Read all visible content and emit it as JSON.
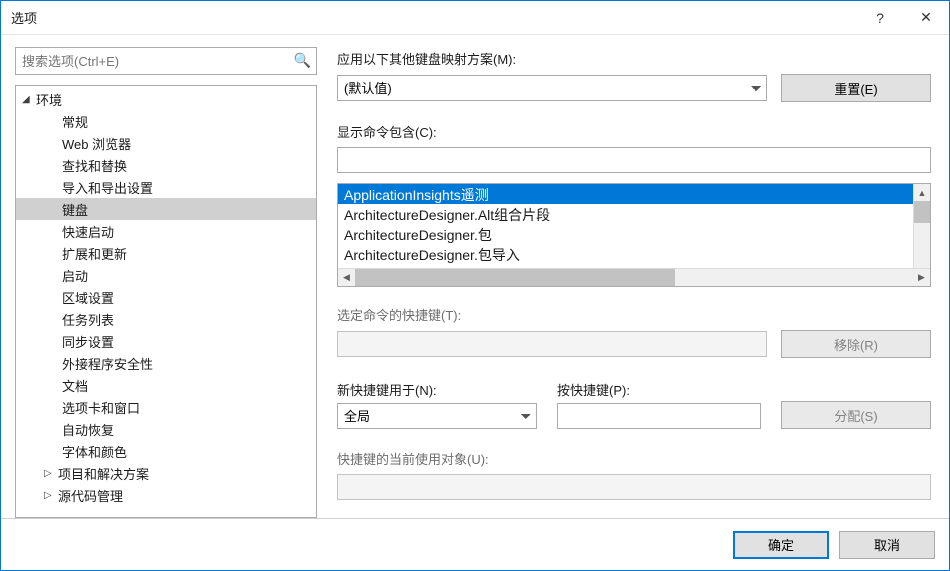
{
  "window": {
    "title": "选项",
    "help": "?",
    "close": "✕"
  },
  "search": {
    "placeholder": "搜索选项(Ctrl+E)",
    "value": ""
  },
  "tree": {
    "root": {
      "label": "环境",
      "expanded": true
    },
    "children": [
      "常规",
      "Web 浏览器",
      "查找和替换",
      "导入和导出设置",
      "键盘",
      "快速启动",
      "扩展和更新",
      "启动",
      "区域设置",
      "任务列表",
      "同步设置",
      "外接程序安全性",
      "文档",
      "选项卡和窗口",
      "自动恢复",
      "字体和颜色"
    ],
    "selectedIndex": 4,
    "siblings": [
      "项目和解决方案",
      "源代码管理"
    ]
  },
  "right": {
    "mappingLabel": "应用以下其他键盘映射方案(M):",
    "mappingValue": "(默认值)",
    "resetBtn": "重置(E)",
    "showCmdLabel": "显示命令包含(C):",
    "showCmdValue": "",
    "commands": [
      "ApplicationInsights遥测",
      "ArchitectureDesigner.Alt组合片段",
      "ArchitectureDesigner.包",
      "ArchitectureDesigner.包导入"
    ],
    "commandSelected": 0,
    "selectedShortcutLabel": "选定命令的快捷键(T):",
    "removeBtn": "移除(R)",
    "newShortcutLabel": "新快捷键用于(N):",
    "newShortcutScope": "全局",
    "pressKeyLabel": "按快捷键(P):",
    "pressKeyValue": "",
    "assignBtn": "分配(S)",
    "currentUseLabel": "快捷键的当前使用对象(U):"
  },
  "footer": {
    "ok": "确定",
    "cancel": "取消"
  }
}
